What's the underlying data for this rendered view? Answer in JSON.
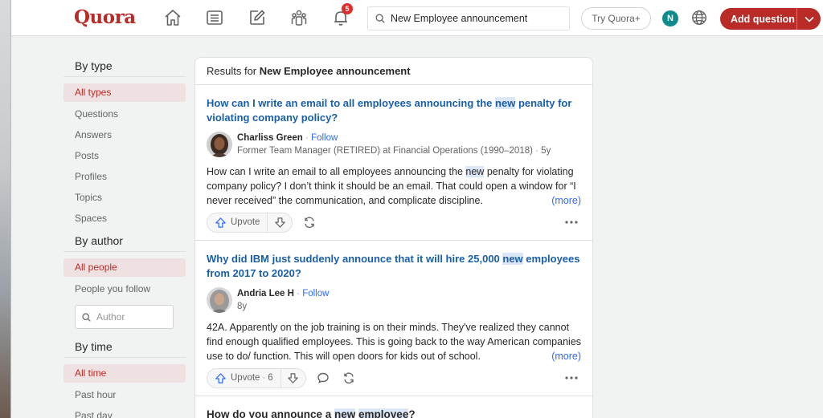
{
  "header": {
    "logo": "Quora",
    "notifications_count": "5",
    "search_value": "New Employee announcement",
    "try_label": "Try Quora+",
    "avatar_initial": "N",
    "add_question_label": "Add question",
    "icons": [
      "home-icon",
      "following-icon",
      "answer-icon",
      "spaces-icon",
      "bell-icon",
      "search-icon",
      "globe-icon",
      "chevron-down-icon"
    ]
  },
  "sidebar": {
    "by_type": {
      "heading": "By type",
      "items": [
        "All types",
        "Questions",
        "Answers",
        "Posts",
        "Profiles",
        "Topics",
        "Spaces"
      ]
    },
    "by_author": {
      "heading": "By author",
      "items": [
        "All people",
        "People you follow"
      ],
      "author_placeholder": "Author"
    },
    "by_time": {
      "heading": "By time",
      "items": [
        "All time",
        "Past hour",
        "Past day"
      ]
    }
  },
  "results": {
    "prefix": "Results for ",
    "query": "New Employee announcement",
    "items": [
      {
        "title_pre": "How can I write an email to all employees announcing the ",
        "title_hl": "new",
        "title_post": " penalty for violating company policy?",
        "author": "Charliss Green",
        "follow": "Follow",
        "credential": "Former Team Manager (RETIRED) at Financial Operations (1990–2018)",
        "age": "5y",
        "answer_pre": "How can I write an email to all employees announcing the ",
        "answer_hl": "new",
        "answer_post": " penalty for violating company policy? I don’t think it should be an email. That could open a window for “I never received” the communication, and complicate discipline.",
        "more": "(more)",
        "upvote": "Upvote",
        "upvote_count": ""
      },
      {
        "title_pre": "Why did IBM just suddenly announce that it will hire 25,000 ",
        "title_hl": "new",
        "title_post": " employees from 2017 to 2020?",
        "author": "Andria Lee H",
        "follow": "Follow",
        "credential": "",
        "age": "8y",
        "answer_pre": "42A. Apparently on the job training is on their minds. They've realized they cannot find enough qualified employees. This is going back to the way American companies use to do/ function. This will open doors for kids out of school.",
        "answer_hl": "",
        "answer_post": "",
        "more": "(more)",
        "upvote": "Upvote",
        "upvote_count": "6"
      },
      {
        "title_pre": "How do you announce a ",
        "title_hl": "new",
        "title_hl2": "employee",
        "title_post": "?"
      }
    ]
  },
  "colors": {
    "brand": "#b92b27",
    "link": "#195faa",
    "highlight": "#dbe6f7",
    "active_bg": "#efe1e1"
  }
}
